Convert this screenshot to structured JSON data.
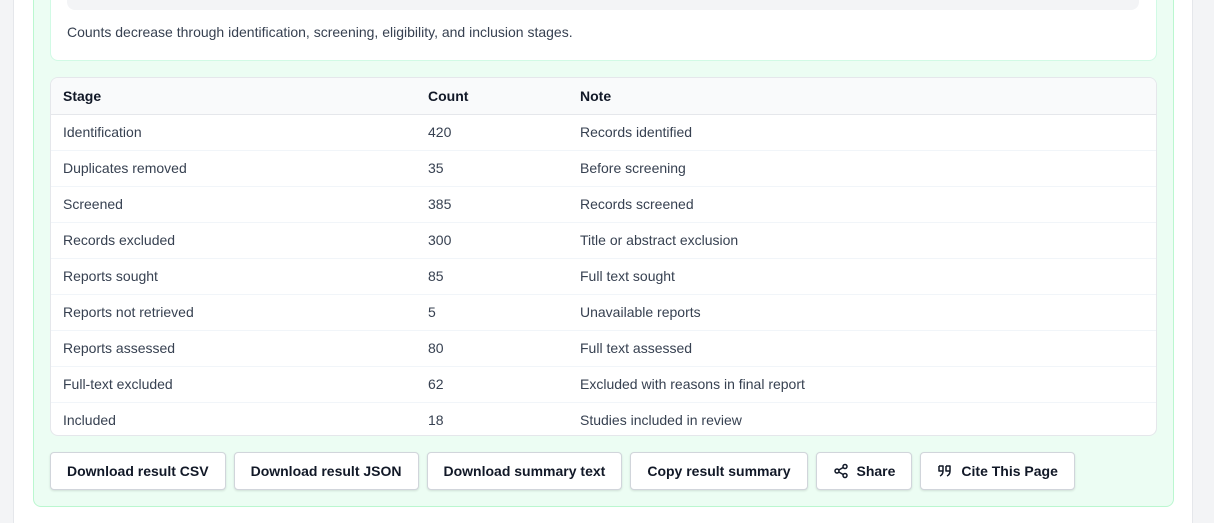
{
  "summary": {
    "text": "Counts decrease through identification, screening, eligibility, and inclusion stages."
  },
  "table": {
    "headers": [
      "Stage",
      "Count",
      "Note"
    ],
    "rows": [
      [
        "Identification",
        "420",
        "Records identified"
      ],
      [
        "Duplicates removed",
        "35",
        "Before screening"
      ],
      [
        "Screened",
        "385",
        "Records screened"
      ],
      [
        "Records excluded",
        "300",
        "Title or abstract exclusion"
      ],
      [
        "Reports sought",
        "85",
        "Full text sought"
      ],
      [
        "Reports not retrieved",
        "5",
        "Unavailable reports"
      ],
      [
        "Reports assessed",
        "80",
        "Full text assessed"
      ],
      [
        "Full-text excluded",
        "62",
        "Excluded with reasons in final report"
      ],
      [
        "Included",
        "18",
        "Studies included in review"
      ]
    ]
  },
  "actions": {
    "download_csv": "Download result CSV",
    "download_json": "Download result JSON",
    "download_summary": "Download summary text",
    "copy_summary": "Copy result summary",
    "share": "Share",
    "cite": "Cite This Page"
  },
  "icons": {
    "share": "share-icon",
    "cite": "quote-icon"
  }
}
